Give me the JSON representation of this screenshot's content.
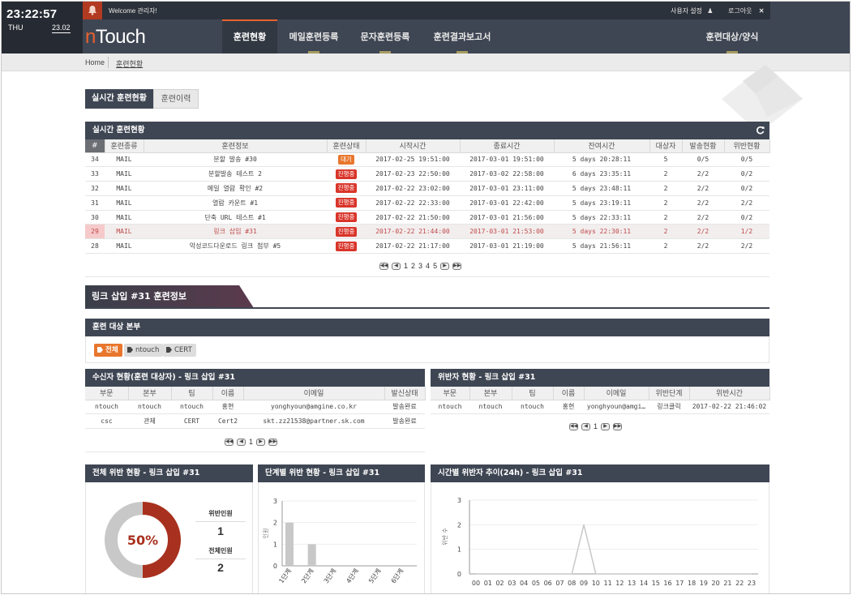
{
  "header": {
    "clock_time": "23:22:57",
    "clock_day": "THU",
    "clock_date": "23.02",
    "welcome": "Welcome 관리자!",
    "user_settings": "사용자 설정",
    "logout": "로그아웃",
    "logo_prefix": "n",
    "logo_main": "Touch",
    "nav": [
      {
        "label": "훈련현황",
        "active": true
      },
      {
        "label": "메일훈련등록",
        "active": false
      },
      {
        "label": "문자훈련등록",
        "active": false
      },
      {
        "label": "훈련결과보고서",
        "active": false
      },
      {
        "label": "훈련대상/양식",
        "active": false
      }
    ],
    "colors": {
      "topbar": "#3f4653",
      "accent": "#e8622f",
      "alert": "#b23a21"
    }
  },
  "breadcrumb": {
    "home": "Home",
    "current": "훈련현황"
  },
  "tabs": {
    "realtime": "실시간 훈련현황",
    "history": "훈련이력"
  },
  "realtime_panel": {
    "title": "실시간 훈련현황",
    "refresh_icon": "refresh-icon",
    "columns": [
      "#",
      "훈련종류",
      "훈련정보",
      "훈련상태",
      "시작시간",
      "종료시간",
      "잔여시간",
      "대상자",
      "발송현황",
      "위반현황"
    ],
    "rows": [
      {
        "id": "34",
        "type": "MAIL",
        "info": "분할 발송 #30",
        "status": "대기",
        "status_color": "#e8762d",
        "start": "2017-02-25 19:51:00",
        "end": "2017-03-01 19:51:00",
        "remain": "5 days 20:28:11",
        "targets": "5",
        "sent": "0/5",
        "violations": "0/5",
        "highlight": false
      },
      {
        "id": "33",
        "type": "MAIL",
        "info": "분할발송 테스트 2",
        "status": "진행중",
        "status_color": "#d9352a",
        "start": "2017-02-23 22:50:00",
        "end": "2017-03-02 22:58:00",
        "remain": "6 days 23:35:11",
        "targets": "2",
        "sent": "2/2",
        "violations": "0/2",
        "highlight": false
      },
      {
        "id": "32",
        "type": "MAIL",
        "info": "메일 열람 확인 #2",
        "status": "진행중",
        "status_color": "#d9352a",
        "start": "2017-02-22 23:02:00",
        "end": "2017-03-01 23:11:00",
        "remain": "5 days 23:48:11",
        "targets": "2",
        "sent": "2/2",
        "violations": "0/2",
        "highlight": false
      },
      {
        "id": "31",
        "type": "MAIL",
        "info": "열람 카운트 #1",
        "status": "진행중",
        "status_color": "#d9352a",
        "start": "2017-02-22 22:33:00",
        "end": "2017-03-01 22:42:00",
        "remain": "5 days 23:19:11",
        "targets": "2",
        "sent": "2/2",
        "violations": "2/2",
        "highlight": false
      },
      {
        "id": "30",
        "type": "MAIL",
        "info": "단축 URL 테스트 #1",
        "status": "진행중",
        "status_color": "#d9352a",
        "start": "2017-02-22 21:50:00",
        "end": "2017-03-01 21:56:00",
        "remain": "5 days 22:33:11",
        "targets": "2",
        "sent": "2/2",
        "violations": "0/2",
        "highlight": false
      },
      {
        "id": "29",
        "type": "MAIL",
        "info": "링크 삽입 #31",
        "status": "진행중",
        "status_color": "#d9352a",
        "start": "2017-02-22 21:44:00",
        "end": "2017-03-01 21:53:00",
        "remain": "5 days 22:30:11",
        "targets": "2",
        "sent": "2/2",
        "violations": "1/2",
        "highlight": true
      },
      {
        "id": "28",
        "type": "MAIL",
        "info": "악성코드다운로드 링크 첨부 #5",
        "status": "진행중",
        "status_color": "#d9352a",
        "start": "2017-02-22 21:17:00",
        "end": "2017-03-01 21:19:00",
        "remain": "5 days 21:56:11",
        "targets": "2",
        "sent": "2/2",
        "violations": "2/2",
        "highlight": false
      }
    ],
    "pages": [
      "1",
      "2",
      "3",
      "4",
      "5"
    ]
  },
  "detail": {
    "section_title": "링크 삽입 #31 훈련정보",
    "target_dept_title": "훈련 대상 본부",
    "chips": [
      "전체",
      "ntouch",
      "CERT"
    ],
    "recipients": {
      "title": "수신자 현황(훈련 대상자) - 링크 삽입 #31",
      "columns": [
        "부문",
        "본부",
        "팀",
        "이름",
        "이메일",
        "발신상태"
      ],
      "rows": [
        [
          "ntouch",
          "ntouch",
          "ntouch",
          "홍현",
          "yonghyoun@amgine.co.kr",
          "발송완료"
        ],
        [
          "csc",
          "관제",
          "CERT",
          "Cert2",
          "skt.zz21538@partner.sk.com",
          "발송완료"
        ]
      ],
      "pages": [
        "1"
      ]
    },
    "violators": {
      "title": "위반자 현황 - 링크 삽입 #31",
      "columns": [
        "부문",
        "본부",
        "팀",
        "이름",
        "이메일",
        "위반단계",
        "위반시간"
      ],
      "rows": [
        [
          "ntouch",
          "ntouch",
          "ntouch",
          "홍현",
          "yonghyoun@amgi…",
          "링크클릭",
          "2017-02-22 21:46:02"
        ]
      ],
      "pages": [
        "1"
      ]
    }
  },
  "chart_data": [
    {
      "type": "pie",
      "title": "전체 위반 현황 - 링크 삽입 #31",
      "center_label": "50%",
      "values": [
        1,
        1
      ],
      "colors": [
        "#a8301e",
        "#c8c8c8"
      ],
      "stats": [
        {
          "label": "위반인원",
          "value": "1"
        },
        {
          "label": "전체인원",
          "value": "2"
        }
      ]
    },
    {
      "type": "bar",
      "title": "단계별 위반 현황 - 링크 삽입 #31",
      "ylabel": "인원",
      "categories": [
        "1단계",
        "2단계",
        "3단계",
        "4단계",
        "5단계",
        "6단계"
      ],
      "values": [
        2,
        1,
        0,
        0,
        0,
        0
      ],
      "ylim": [
        0,
        3
      ],
      "yticks": [
        "0",
        "1",
        "2",
        "3"
      ],
      "color": "#c8c8c8"
    },
    {
      "type": "line",
      "title": "시간별 위반자 추이(24h) - 링크 삽입 #31",
      "ylabel": "위반 수",
      "x": [
        "00",
        "01",
        "02",
        "03",
        "04",
        "05",
        "06",
        "07",
        "08",
        "09",
        "10",
        "11",
        "12",
        "13",
        "14",
        "15",
        "16",
        "17",
        "18",
        "19",
        "20",
        "21",
        "22",
        "23"
      ],
      "values": [
        0,
        0,
        0,
        0,
        0,
        0,
        0,
        0,
        0,
        2,
        0,
        0,
        0,
        0,
        0,
        0,
        0,
        0,
        0,
        0,
        0,
        0,
        0,
        0
      ],
      "ylim": [
        0,
        3
      ],
      "yticks": [
        "0",
        "1",
        "2",
        "3"
      ],
      "color": "#c8c8c8"
    }
  ]
}
